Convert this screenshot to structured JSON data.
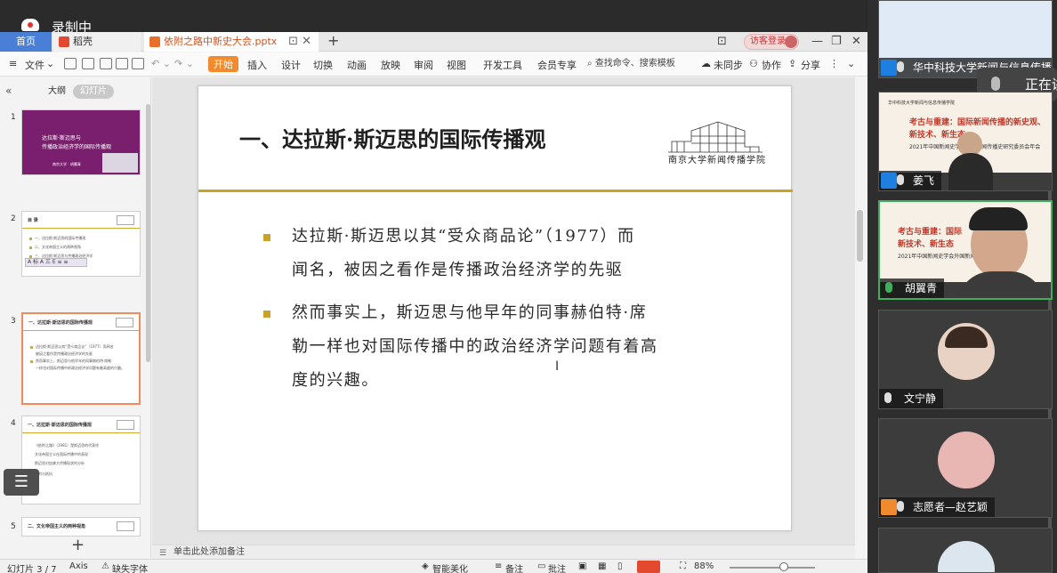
{
  "recording": {
    "label": "录制中"
  },
  "tabs": {
    "home": "首页",
    "docer": "稻壳",
    "file": "依附之路中新史大会.pptx",
    "login": "访客登录"
  },
  "menu": {
    "file": "文件",
    "start": "开始",
    "insert": "插入",
    "design": "设计",
    "transition": "切换",
    "animation": "动画",
    "slideshow": "放映",
    "review": "审阅",
    "view": "视图",
    "devtools": "开发工具",
    "member": "会员专享",
    "search": "查找命令、搜索模板",
    "sync": "未同步",
    "collab": "协作",
    "share": "分享"
  },
  "side": {
    "outline": "大纲",
    "slides": "幻灯片",
    "thumbs": [
      {
        "num": "1",
        "a": "达拉斯·斯迈思与",
        "b": "传播政治经济学的国际传播观",
        "c": "南京大学 · 胡翼青"
      },
      {
        "num": "2",
        "title": "目  录",
        "items": [
          "一、达拉斯·斯迈思的国际传播观",
          "二、文化帝国主义的两种视角",
          "三、达拉斯·斯迈思与传播政治经济学"
        ]
      },
      {
        "num": "3",
        "title": "一、达拉斯·斯迈思的国际传播观",
        "items": [
          "达拉斯·斯迈思以其“受众商品论”（1977）而闻名",
          "被因之看作是传播政治经济学的先驱",
          "然而事实上，斯迈思与他早年的同事赫伯特·席勒",
          "一样也对国际传播中的政治经济学问题有着高度的兴趣。"
        ]
      },
      {
        "num": "4",
        "title": "一、达拉斯·斯迈思的国际传播观",
        "items": [
          "《依附之路》（1981）是斯迈思的代表作",
          "文化帝国主义在国际传播中的表现",
          "斯迈思对加拿大传播现状的分析",
          "依附与抵抗"
        ]
      },
      {
        "num": "5",
        "title": "二、文化帝国主义的两种视角"
      }
    ],
    "mini_toolbar": "A 标 A 三 E ≡ ≡"
  },
  "slide": {
    "title": "一、达拉斯·斯迈思的国际传播观",
    "logo_text": "南京大学新闻传播学院",
    "bullets": [
      {
        "lines": [
          "达拉斯·斯迈思以其“受众商品论”（1977）而",
          "闻名，被因之看作是传播政治经济学的先驱"
        ]
      },
      {
        "lines": [
          "然而事实上，斯迈思与他早年的同事赫伯特·席",
          "勒一样也对国际传播中的政治经济学问题有着高",
          "度的兴趣。"
        ]
      }
    ]
  },
  "notes": {
    "placeholder": "单击此处添加备注"
  },
  "status": {
    "slide_count": "幻灯片 3 / 7",
    "theme": "Axis",
    "missing_font": "缺失字体",
    "beautify": "智能美化",
    "notes": "备注",
    "comment": "批注",
    "zoom": "88%"
  },
  "participants": [
    {
      "name": "华中科技大学新闻与信息传播学院",
      "mini": {
        "t0": "",
        "t1": "",
        "t2": ""
      }
    },
    {
      "name": "姜飞",
      "mini": {
        "t0": "华中科技大学新闻与信息传播学院",
        "t1": "考古与重建：国际新闻传播的新史观、",
        "t2": "新技术、新生态",
        "t3": "2021年中国新闻史学会外国新闻传播史研究委员会年会"
      }
    },
    {
      "name": "胡翼青",
      "mini": {
        "t0": "",
        "t1": "考古与重建：国际",
        "t2": "新技术、新生态",
        "t3": "2021年中国新闻史学会外国新闻传播史"
      }
    },
    {
      "name": "文宁静"
    },
    {
      "name": "志愿者—赵艺颖"
    },
    {
      "name": ""
    }
  ],
  "speaking": {
    "label": "正在讲话"
  },
  "colors": {
    "accent": "#c9a22a",
    "wps_orange": "#f28a2e",
    "title_red": "#c0392b"
  }
}
